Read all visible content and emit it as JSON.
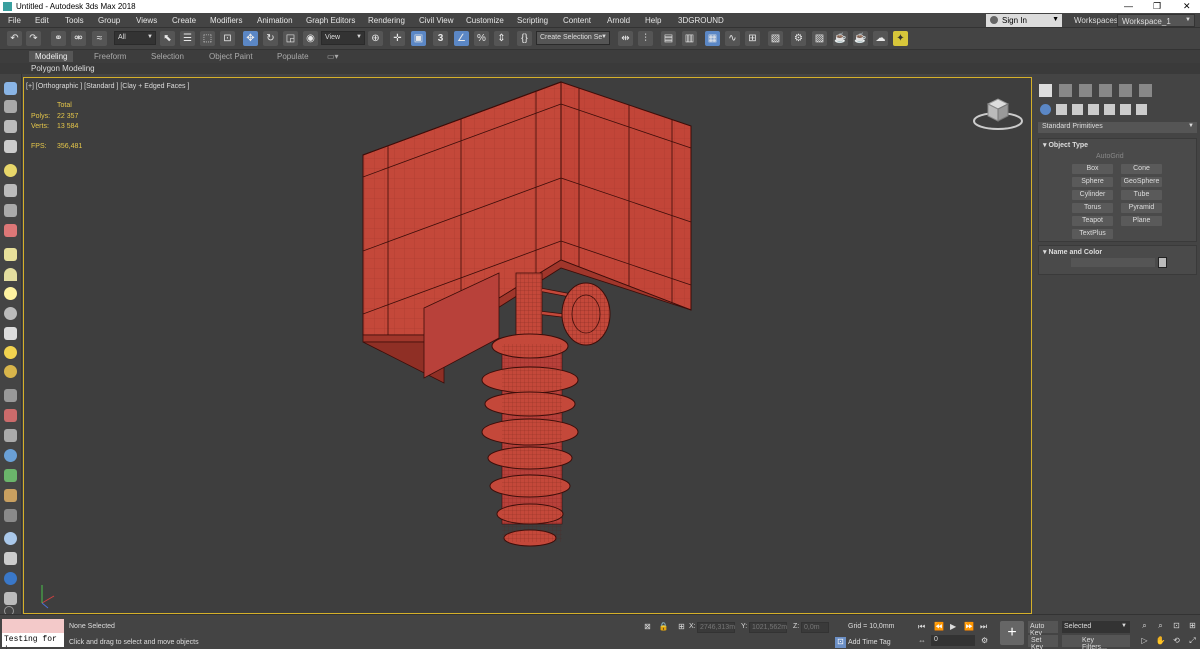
{
  "window": {
    "title": "Untitled - Autodesk 3ds Max 2018"
  },
  "menus": [
    "File",
    "Edit",
    "Tools",
    "Group",
    "Views",
    "Create",
    "Modifiers",
    "Animation",
    "Graph Editors",
    "Rendering",
    "Civil View",
    "Customize",
    "Scripting",
    "Content",
    "Arnold",
    "Help",
    "3DGROUND"
  ],
  "account": {
    "sign_in": "Sign In",
    "workspaces_label": "Workspaces:",
    "workspace": "Workspace_1"
  },
  "toolbar": {
    "selection_filter": "All",
    "ref_coord": "View",
    "named_selection": "Create Selection Se"
  },
  "ribbon": {
    "tabs": [
      "Modeling",
      "Freeform",
      "Selection",
      "Object Paint",
      "Populate"
    ],
    "active_tab": "Modeling",
    "subpanel": "Polygon Modeling"
  },
  "viewport": {
    "label": "[+] [Orthographic ] [Standard ] [Clay + Edged Faces ]",
    "stats": {
      "total_label": "Total",
      "polys_label": "Polys:",
      "polys": "22 357",
      "verts_label": "Verts:",
      "verts": "13 584",
      "fps_label": "FPS:",
      "fps": "356,481"
    },
    "model_color": "#c4483a",
    "border_color": "#d5b02a"
  },
  "command_panel": {
    "category": "Standard Primitives",
    "object_type": {
      "title": "Object Type",
      "autogrid": "AutoGrid",
      "buttons": [
        "Box",
        "Cone",
        "Sphere",
        "GeoSphere",
        "Cylinder",
        "Tube",
        "Torus",
        "Pyramid",
        "Teapot",
        "Plane",
        "TextPlus"
      ]
    },
    "name_color": {
      "title": "Name and Color"
    }
  },
  "status": {
    "maxscript": "Testing for :",
    "selection": "None Selected",
    "prompt": "Click and drag to select and move objects",
    "x_label": "X:",
    "x": "2746,313m",
    "y_label": "Y:",
    "y": "1021,562m",
    "z_label": "Z:",
    "z": "0,0m",
    "grid": "Grid = 10,0mm",
    "add_time_tag": "Add Time Tag",
    "frame": "0",
    "auto_key": "Auto Key",
    "set_key": "Set Key",
    "selected": "Selected",
    "key_filters": "Key Filters..."
  }
}
